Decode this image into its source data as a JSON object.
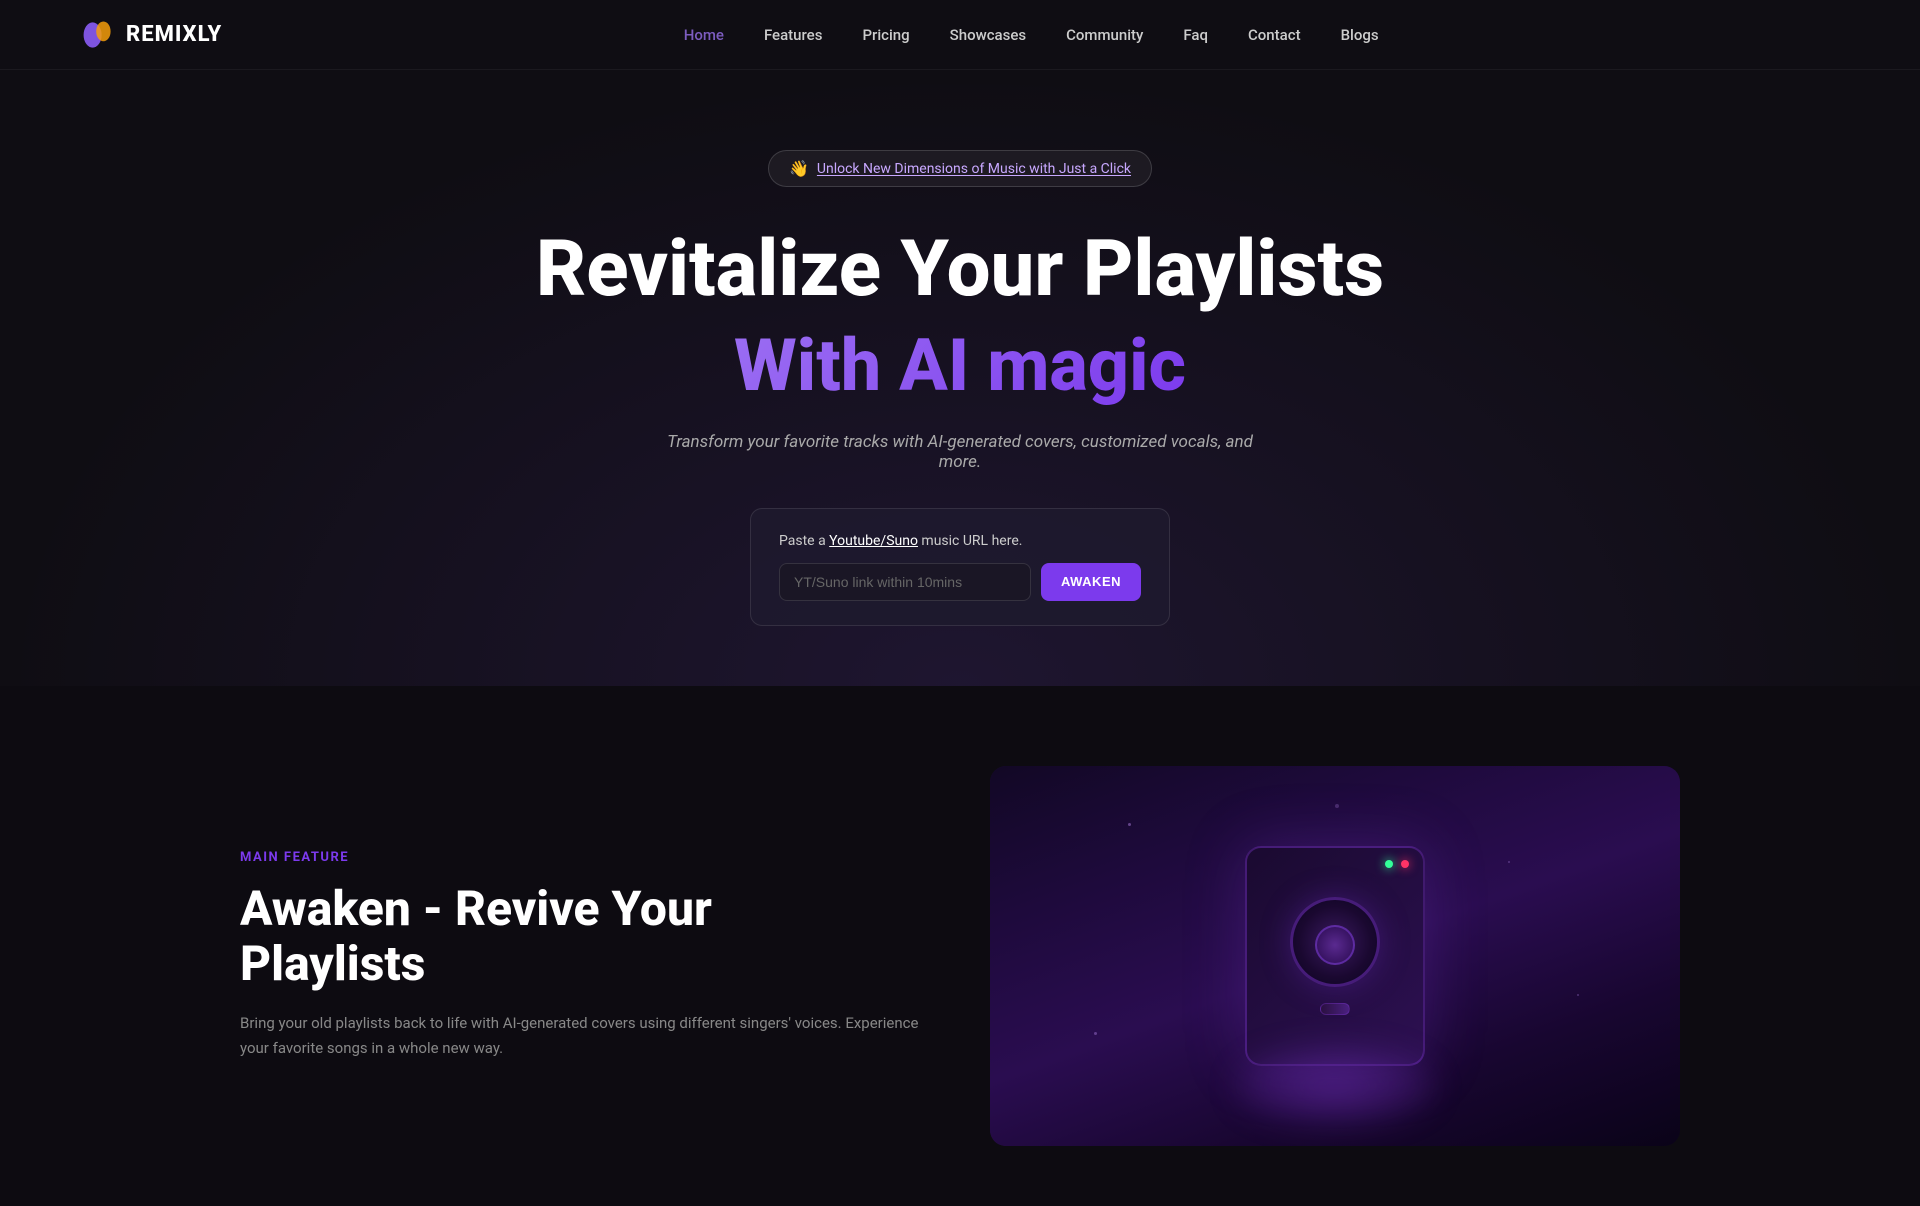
{
  "brand": {
    "name": "REMIXLY",
    "logo_alt": "Remixly Logo"
  },
  "navbar": {
    "links": [
      {
        "label": "Home",
        "href": "#",
        "active": true
      },
      {
        "label": "Features",
        "href": "#",
        "active": false
      },
      {
        "label": "Pricing",
        "href": "#",
        "active": false
      },
      {
        "label": "Showcases",
        "href": "#",
        "active": false
      },
      {
        "label": "Community",
        "href": "#",
        "active": false
      },
      {
        "label": "Faq",
        "href": "#",
        "active": false
      },
      {
        "label": "Contact",
        "href": "#",
        "active": false
      },
      {
        "label": "Blogs",
        "href": "#",
        "active": false
      }
    ]
  },
  "hero": {
    "badge_icon": "👋",
    "badge_text": "Unlock New Dimensions of Music with Just a Click",
    "title_line1": "Revitalize Your Playlists",
    "title_line2": "With AI magic",
    "description": "Transform your favorite tracks with AI-generated covers, customized vocals, and more.",
    "url_box": {
      "label_prefix": "Paste a ",
      "label_link": "Youtube/Suno",
      "label_suffix": " music URL here.",
      "input_placeholder": "YT/Suno link within 10mins",
      "button_label": "AWAKEN"
    }
  },
  "features_section": {
    "section_label": "MAIN FEATURE",
    "feature_title_line1": "Awaken - Revive Your",
    "feature_title_line2": "Playlists",
    "feature_description": "Bring your old playlists back to life with AI-generated covers using different singers' voices. Experience your favorite songs in a whole new way."
  }
}
